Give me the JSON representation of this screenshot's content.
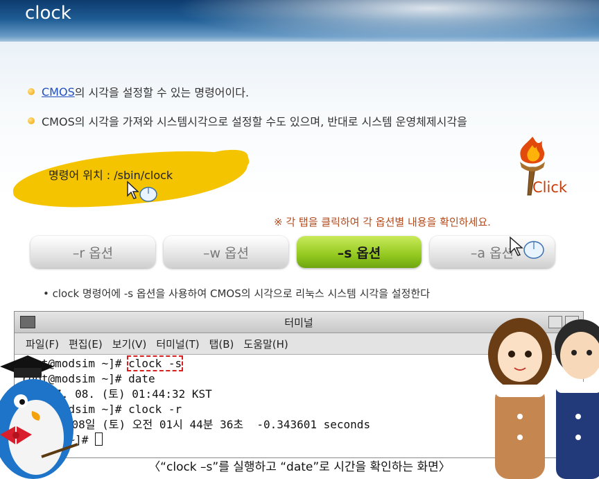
{
  "header": {
    "title": "clock"
  },
  "bullets": [
    {
      "link": "CMOS",
      "text": "의 시각을 설정할 수 있는 명령어이다."
    },
    {
      "text": "CMOS의 시각을 가져와 시스템시각으로 설정할 수도 있으며, 반대로 시스템 운영체제시각을"
    }
  ],
  "command_location": "명령어 위치 : /sbin/clock",
  "click_label": "Click",
  "note": "※ 각 탭을 클릭하여 각 옵션별 내용을 확인하세요.",
  "tabs": [
    {
      "label": "–r 옵션",
      "active": false
    },
    {
      "label": "–w 옵션",
      "active": false
    },
    {
      "label": "–s 옵션",
      "active": true
    },
    {
      "label": "–a 옵션",
      "active": false
    }
  ],
  "description": "• clock 명령어에 -s 옵션을 사용하여 CMOS의 시각으로 리눅스 시스템 시각을 설정한다",
  "terminal": {
    "title": "터미널",
    "menu": [
      "파일(F)",
      "편집(E)",
      "보기(V)",
      "터미널(T)",
      "탭(B)",
      "도움말(H)"
    ],
    "lines": [
      {
        "prompt": "root@modsim ~]# ",
        "cmd": "clock -s"
      },
      {
        "text": "root@modsim ~]# date"
      },
      {
        "text": "06. 07. 08. (토) 01:44:32 KST"
      },
      {
        "text": "root@modsim ~]# clock -r"
      },
      {
        "text": "   07월 08일 (토) 오전 01시 44분 36초  -0.343601 seconds"
      },
      {
        "prompt": "modsim ~]# "
      }
    ]
  },
  "caption": "〈“clock –s”를 실행하고 “date”로 시간을 확인하는 화면〉",
  "colors": {
    "active_tab": "#93c91f",
    "note": "#b24a1c",
    "link": "#1f4fbf",
    "highlight_border": "#d62020"
  }
}
